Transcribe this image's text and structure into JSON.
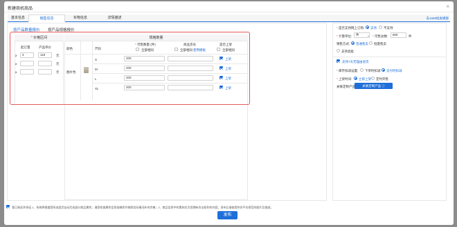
{
  "modal": {
    "title": "新建商机商品",
    "close_icon": "close-icon"
  },
  "tabs": [
    {
      "label": "基本信息"
    },
    {
      "label": "销售信息"
    },
    {
      "label": "实物信息"
    },
    {
      "label": "详情描述"
    }
  ],
  "tab_link": "去1688批发模版",
  "subtabs": [
    {
      "label": "按产品数量报价"
    },
    {
      "label": "按产品规格报价"
    }
  ],
  "price": {
    "header_req": "*",
    "header": "价格区间",
    "col_min": "起订量",
    "col_price": "产品单价",
    "rows": [
      {
        "prefix": "≥",
        "min": "3",
        "price": "118",
        "unit": "元"
      },
      {
        "prefix": "≥",
        "min": "",
        "price": "",
        "unit": "元"
      },
      {
        "prefix": "≥",
        "min": "",
        "price": "",
        "unit": "元"
      }
    ]
  },
  "spec": {
    "header": "规格数量",
    "col_color": "颜色",
    "col_size": "尺码",
    "col_qty_req": "*",
    "col_qty": "可售数量 (件)",
    "col_qty_all": "全部相同",
    "col_code": "商品货号",
    "col_code_all": "全部相同",
    "col_code_link": "使用模板",
    "col_shelf": "是否上架",
    "col_shelf_all": "全部相同",
    "color_name": "图片色",
    "rows": [
      {
        "size": "S",
        "qty": "200",
        "code": "",
        "shelf": "上架"
      },
      {
        "size": "M",
        "qty": "200",
        "code": "",
        "shelf": "上架"
      },
      {
        "size": "L",
        "qty": "200",
        "code": "",
        "shelf": "上架"
      },
      {
        "size": "XL",
        "qty": "200",
        "code": "",
        "shelf": "上架"
      }
    ]
  },
  "side": {
    "online_label": "是否支持网上订购:",
    "online_yes": "支持",
    "online_no": "不支持",
    "unit_label": "计量单位:",
    "unit_value": "件",
    "qty_label": "可售总数:",
    "qty_value": "800",
    "qty_unit": "件",
    "sale_label": "销售方式:",
    "sale_normal": "普通售卖",
    "sale_batch": "批量售卖",
    "mix_label": "支持混批",
    "support_label": "支持7天无理由退货",
    "stock_label": "库存扣减设置:",
    "stock_order": "下单时扣减",
    "stock_pay": "支付时扣减",
    "shelf_label": "上架时间:",
    "shelf_now": "立即上架",
    "shelf_plan": "定时开售",
    "custom_label": "关联定制产品:",
    "custom_btn": "关联定制产品 ⓘ"
  },
  "footer": {
    "agree_text": "我已阅读并承诺 1、系统将根据您所选类目自动生成部分商品属性，请您检查属性信息准确性并按照实际情况补充完善；2、商品信息中的素材应为您拥有合法权利的内容，发布后请使用符合平台规范的图片及描述。",
    "publish": "发布"
  }
}
